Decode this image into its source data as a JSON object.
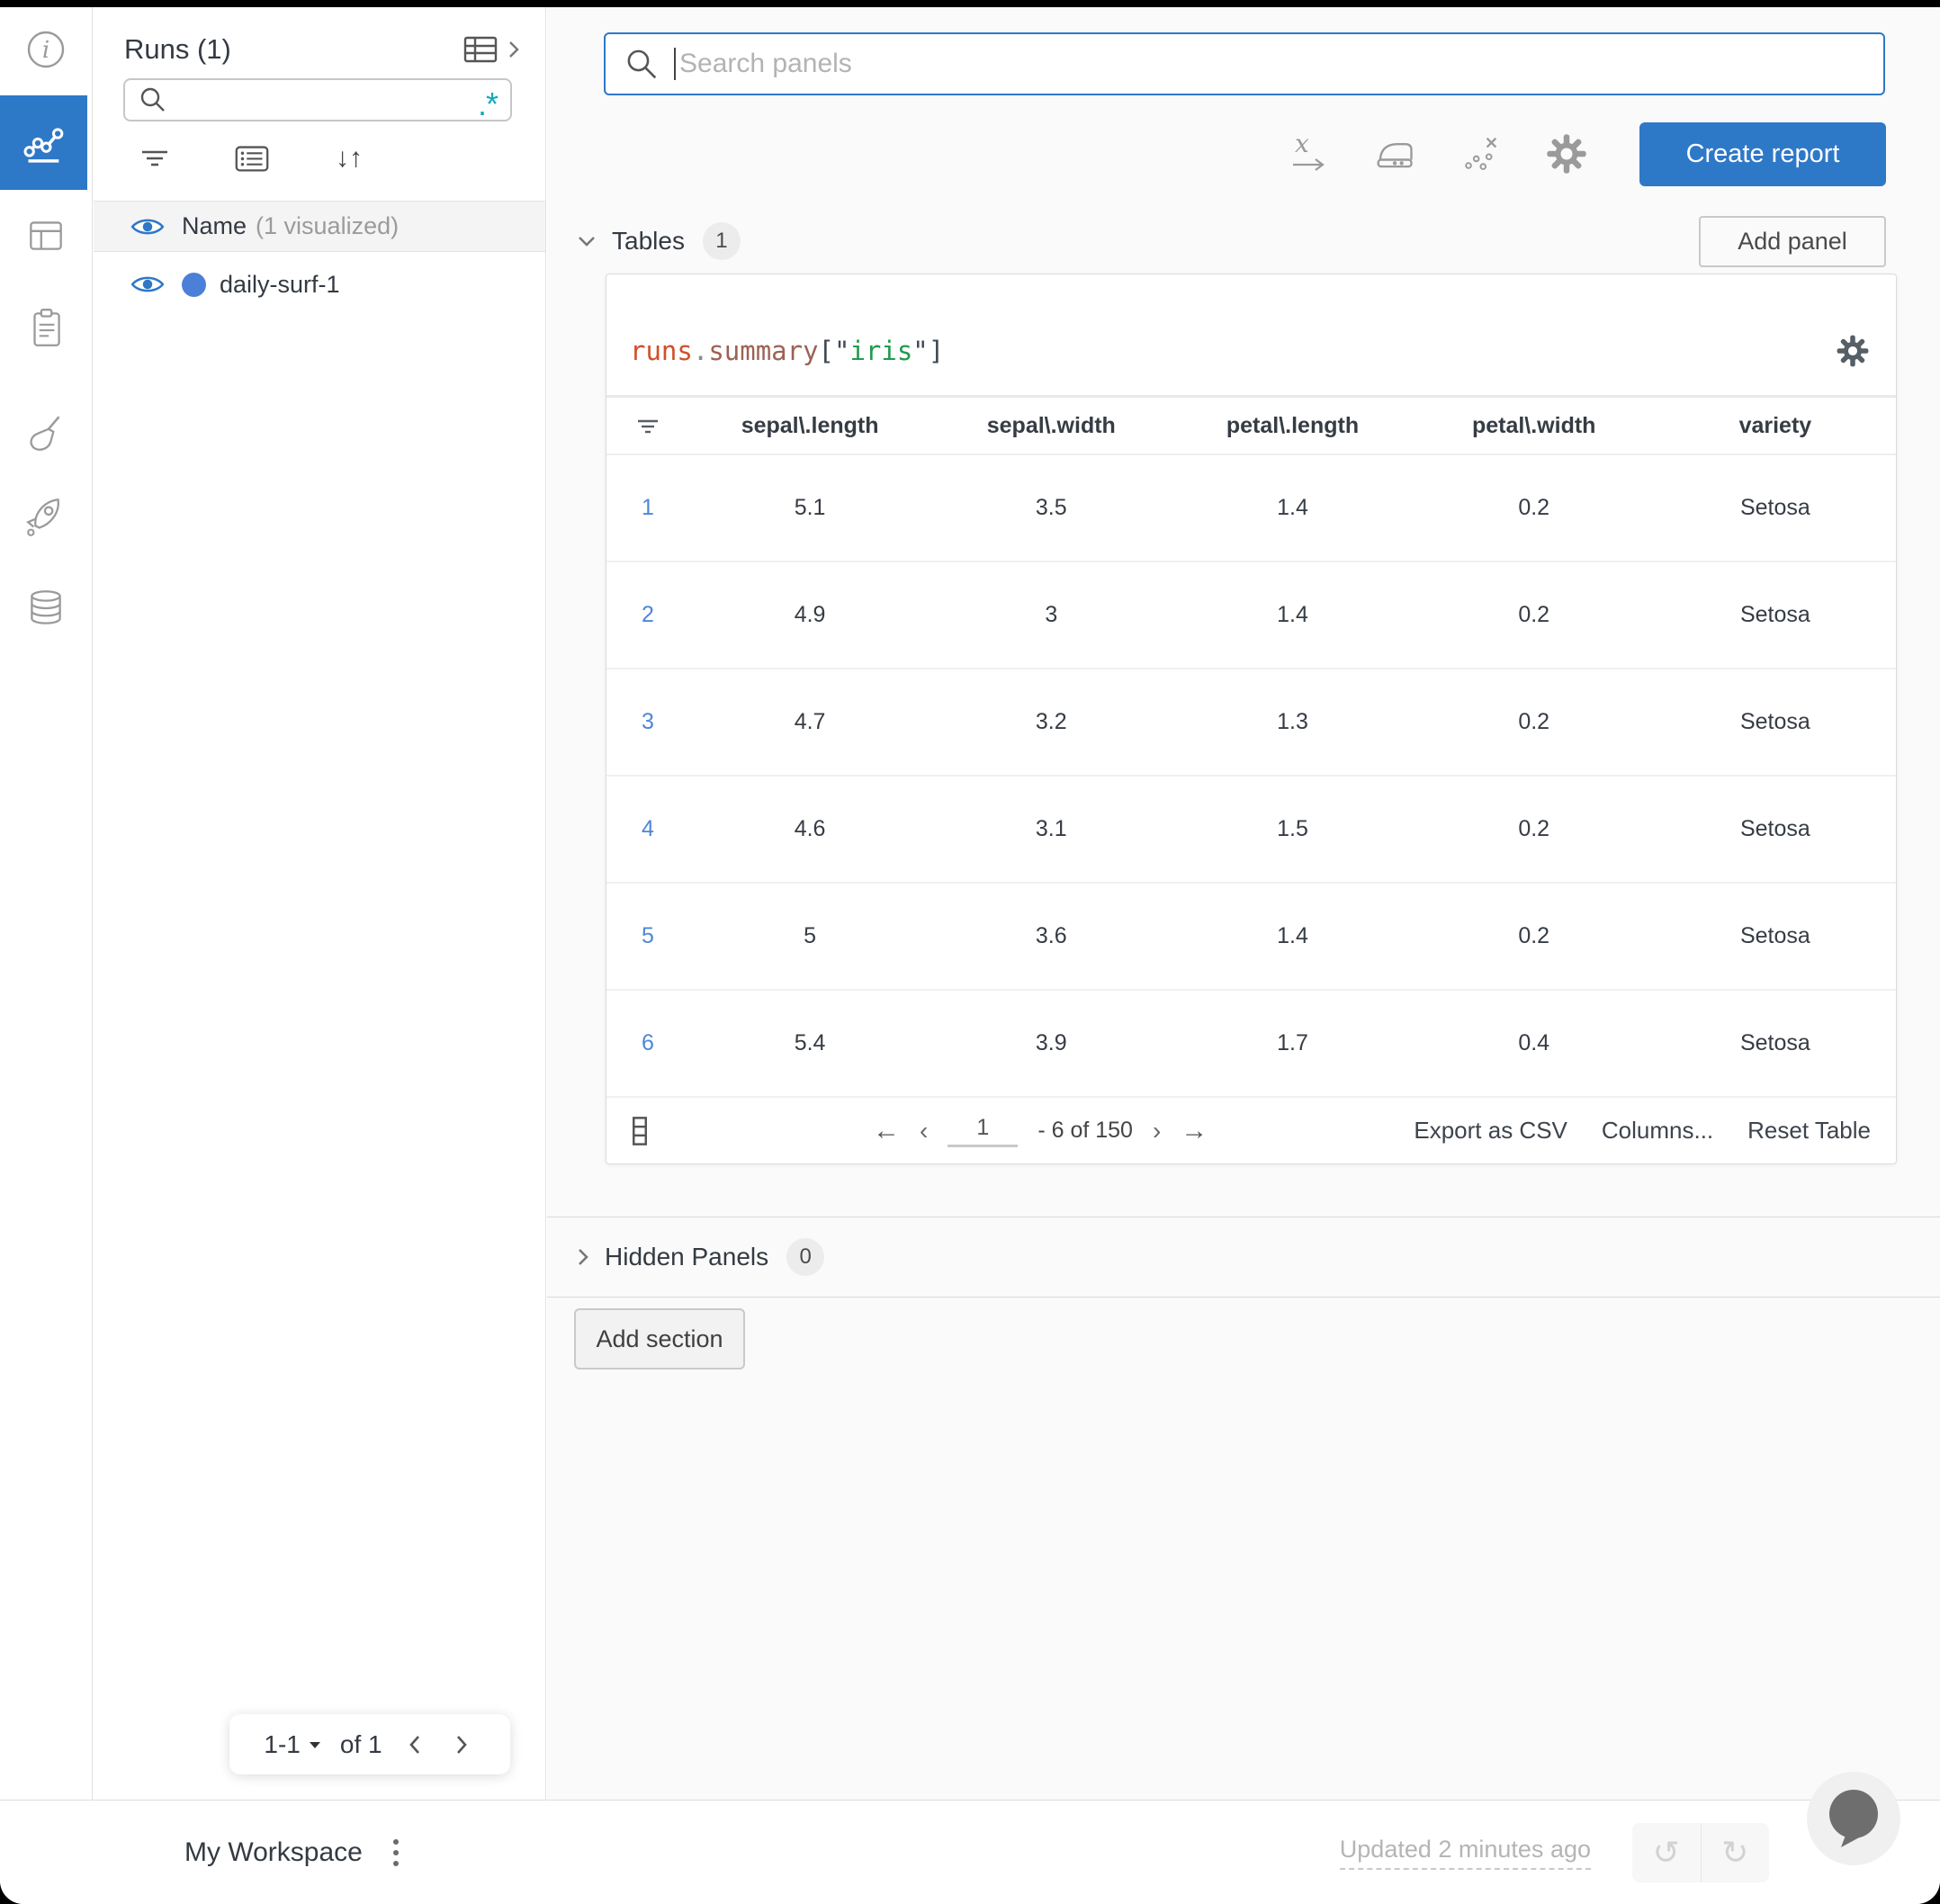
{
  "colors": {
    "accent_blue": "#2e78c8",
    "link_blue": "#4e86d6",
    "run_dot_blue": "#4c80d8",
    "teal_regex": "#13a8b8",
    "code_obj_color": "#d14f28",
    "code_attr_color": "#9c6253",
    "code_key_color": "#1f9b4d"
  },
  "left_rail": {
    "icons": [
      "info-icon",
      "line-chart-icon",
      "panel-layout-icon",
      "clipboard-icon",
      "broom-icon",
      "rocket-icon",
      "database-icon"
    ],
    "selected_icon": "line-chart-icon"
  },
  "runs_panel": {
    "title": "Runs (1)",
    "search_value": "",
    "regex_glyph": ".*",
    "header_row": {
      "name_label": "Name",
      "visualized_label": "(1 visualized)"
    },
    "runs": [
      {
        "name": "daily-surf-1"
      }
    ],
    "pager": {
      "range": "1-1",
      "of_label": "of 1",
      "prev": "<",
      "next": ">"
    }
  },
  "topbar": {
    "search_placeholder": "Search panels",
    "create_report_label": "Create report"
  },
  "sections": {
    "tables_label": "Tables",
    "tables_count": "1",
    "add_panel_label": "Add panel",
    "hidden_label": "Hidden Panels",
    "hidden_count": "0",
    "add_section_label": "Add section"
  },
  "table_panel": {
    "title": {
      "obj": "runs",
      "dot": ".",
      "attr": "summary",
      "open": "[\"",
      "key": "iris",
      "close": "\"]"
    },
    "columns": [
      "sepal\\.length",
      "sepal\\.width",
      "petal\\.length",
      "petal\\.width",
      "variety"
    ],
    "rows": [
      {
        "index": "1",
        "cells": [
          "5.1",
          "3.5",
          "1.4",
          "0.2",
          "Setosa"
        ]
      },
      {
        "index": "2",
        "cells": [
          "4.9",
          "3",
          "1.4",
          "0.2",
          "Setosa"
        ]
      },
      {
        "index": "3",
        "cells": [
          "4.7",
          "3.2",
          "1.3",
          "0.2",
          "Setosa"
        ]
      },
      {
        "index": "4",
        "cells": [
          "4.6",
          "3.1",
          "1.5",
          "0.2",
          "Setosa"
        ]
      },
      {
        "index": "5",
        "cells": [
          "5",
          "3.6",
          "1.4",
          "0.2",
          "Setosa"
        ]
      },
      {
        "index": "6",
        "cells": [
          "5.4",
          "3.9",
          "1.7",
          "0.4",
          "Setosa"
        ]
      }
    ],
    "footer": {
      "page_value": "1",
      "range_label": "- 6 of 150",
      "prev_arrow": "←",
      "prev_angle": "‹",
      "next_angle": "›",
      "next_arrow": "→",
      "export_label": "Export as CSV",
      "columns_label": "Columns...",
      "reset_label": "Reset Table"
    }
  },
  "bottom_bar": {
    "workspace_label": "My Workspace",
    "updated_label": "Updated 2 minutes ago",
    "undo_glyph": "↺",
    "redo_glyph": "↻"
  }
}
